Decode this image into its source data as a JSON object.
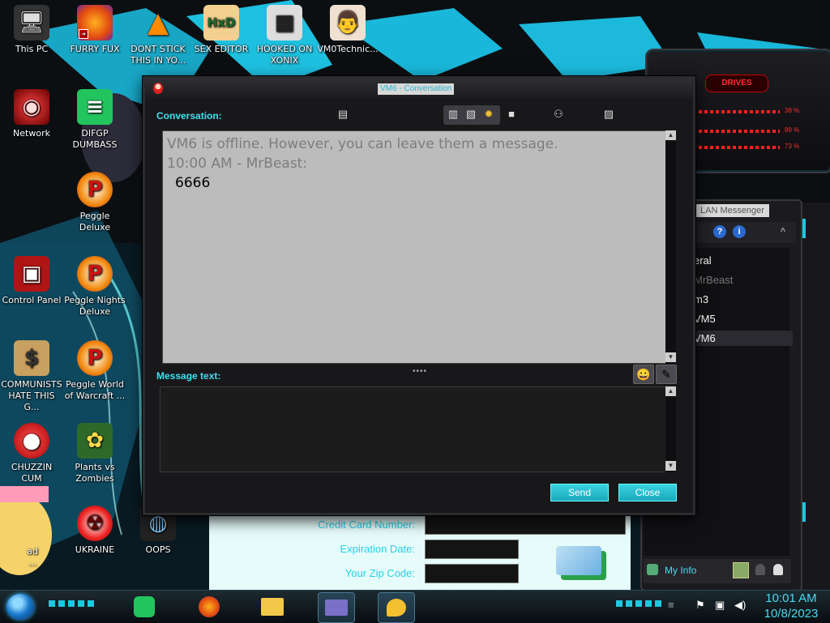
{
  "desktop_icons": [
    {
      "label_1": "This PC",
      "label_2": "",
      "icon": "pc-icon",
      "glyph": "🖥"
    },
    {
      "label_1": "FURRY FUX",
      "label_2": "",
      "icon": "firefox-icon",
      "glyph": "🦊"
    },
    {
      "label_1": "DONT STICK",
      "label_2": "THIS IN YO...",
      "icon": "vlc-icon",
      "glyph": "▲"
    },
    {
      "label_1": "SEX EDITOR",
      "label_2": "",
      "icon": "hxd-icon",
      "glyph": "HxD"
    },
    {
      "label_1": "HOOKED ON",
      "label_2": "XONIX",
      "icon": "maze-icon",
      "glyph": "▦"
    },
    {
      "label_1": "VM0Technic...",
      "label_2": "",
      "icon": "doctor-icon",
      "glyph": "👨"
    },
    {
      "label_1": "Network",
      "label_2": "",
      "icon": "network-icon",
      "glyph": "◉"
    },
    {
      "label_1": "DIFGP",
      "label_2": "DUMBASS",
      "icon": "document-icon",
      "glyph": "≡"
    },
    {
      "label_1": "Peggle Deluxe",
      "label_2": "",
      "icon": "peggle-icon",
      "glyph": "P"
    },
    {
      "label_1": "Control Panel",
      "label_2": "",
      "icon": "control-panel-icon",
      "glyph": "▣"
    },
    {
      "label_1": "Peggle Nights",
      "label_2": "Deluxe",
      "icon": "peggle-nights-icon",
      "glyph": "P"
    },
    {
      "label_1": "COMMUNISTS",
      "label_2": "HATE THIS G...",
      "icon": "money-bag-icon",
      "glyph": "$"
    },
    {
      "label_1": "Peggle World",
      "label_2": "of Warcraft ...",
      "icon": "peggle-warcraft-icon",
      "glyph": "P"
    },
    {
      "label_1": "CHUZZIN",
      "label_2": "CUM",
      "icon": "chuzzle-icon",
      "glyph": "●"
    },
    {
      "label_1": "Plants vs",
      "label_2": "Zombies",
      "icon": "pvz-icon",
      "glyph": "✿"
    },
    {
      "label_1": "ad",
      "label_2": "...",
      "icon": "partial-icon",
      "glyph": ""
    },
    {
      "label_1": "UKRAINE",
      "label_2": "",
      "icon": "radiation-icon",
      "glyph": "☢"
    },
    {
      "label_1": "OOPS",
      "label_2": "",
      "icon": "oops-icon",
      "glyph": "◍"
    }
  ],
  "drives_gadget": {
    "title": "DRIVES",
    "rows": [
      {
        "label": "38 %"
      },
      {
        "label": "89 %"
      },
      {
        "label": "73 %"
      }
    ]
  },
  "lan_messenger": {
    "title": "LAN Messenger",
    "items": [
      "eral",
      "MrBeast",
      "m3",
      "VM5",
      "VM6"
    ],
    "footer_label": "My Info"
  },
  "payment_form": {
    "card_label": "Credit Card Number:",
    "expiry_label": "Expiration Date:",
    "zip_label": "Your Zip Code:"
  },
  "conversation": {
    "window_title": "VM6 - Conversation",
    "conversation_label": "Conversation:",
    "offline_notice": "VM6 is offline. However, you can leave them a message.",
    "message_header": "10:00 AM - MrBeast:",
    "message_body": "6666",
    "message_text_label": "Message text:",
    "message_input_value": "",
    "send_label": "Send",
    "close_label": "Close"
  },
  "taskbar": {
    "time": "10:01 AM",
    "date": "10/8/2023"
  },
  "colors": {
    "accent_cyan": "#40e0f0",
    "button_cyan": "#1aa8bd",
    "drives_red": "#ff2a2a"
  }
}
